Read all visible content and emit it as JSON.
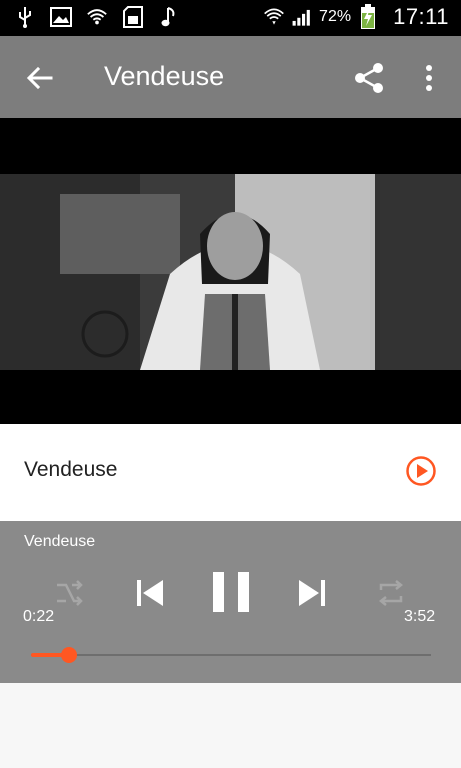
{
  "status_bar": {
    "battery_percent": "72%",
    "clock": "17:11",
    "icons": [
      "usb-icon",
      "gallery-icon",
      "wifi-question-icon",
      "sd-card-icon",
      "music-note-icon",
      "wifi-icon",
      "signal-icon",
      "battery-charging-icon"
    ]
  },
  "app_bar": {
    "title": "Vendeuse",
    "back_icon": "arrow-left-icon",
    "share_icon": "share-icon",
    "more_icon": "more-vert-icon"
  },
  "video": {
    "description_icon": "video-frame"
  },
  "song": {
    "name": "Vendeuse",
    "accent": "#ff5722"
  },
  "player": {
    "title": "Vendeuse",
    "elapsed": "0:22",
    "duration": "3:52",
    "progress": 0.095,
    "buttons": [
      "shuffle-icon",
      "previous-icon",
      "pause-icon",
      "next-icon",
      "repeat-icon"
    ]
  }
}
